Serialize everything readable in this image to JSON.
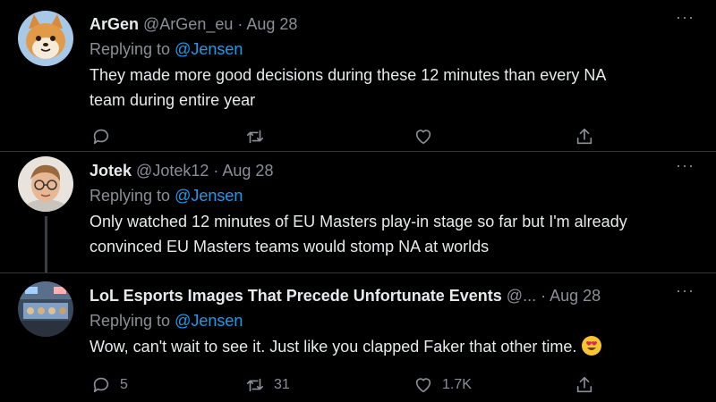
{
  "tweets": [
    {
      "name": "ArGen",
      "handle": "@ArGen_eu",
      "separator": "·",
      "date": "Aug 28",
      "replying_prefix": "Replying to",
      "replying_to": "@Jensen",
      "lines": [
        "They made more good decisions during these 12 minutes than every NA",
        "team during entire year"
      ],
      "more_label": "···",
      "avatar_icon": "shiba-dog-avatar",
      "actions": {
        "reply": "",
        "retweet": "",
        "like": "",
        "share": ""
      }
    },
    {
      "name": "Jotek",
      "handle": "@Jotek12",
      "separator": "·",
      "date": "Aug 28",
      "replying_prefix": "Replying to",
      "replying_to": "@Jensen",
      "lines": [
        "Only watched 12 minutes of EU Masters play-in stage so far but I'm already",
        "convinced EU Masters teams would stomp NA at worlds"
      ],
      "more_label": "···",
      "avatar_icon": "boy-with-glasses-avatar"
    },
    {
      "name": "LoL Esports Images That Precede Unfortunate Events",
      "handle": "@...",
      "separator": "·",
      "date": "Aug 28",
      "replying_prefix": "Replying to",
      "replying_to": "@Jensen",
      "lines": [
        "Wow, can't wait to see it. Just like you clapped Faker that other time."
      ],
      "emoji": "heart-eyes-emoji",
      "more_label": "···",
      "avatar_icon": "esports-stage-avatar",
      "actions": {
        "reply": "5",
        "retweet": "31",
        "like": "1.7K",
        "share": ""
      }
    }
  ],
  "colors": {
    "background": "#000000",
    "text": "#e7e9ea",
    "muted": "#8b8f94",
    "mention": "#1d9bf0",
    "divider": "#2f3336"
  }
}
